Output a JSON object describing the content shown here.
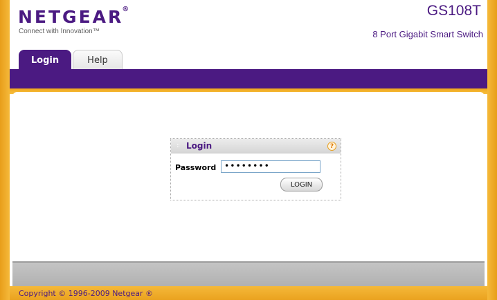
{
  "header": {
    "logo": "NETGEAR",
    "logo_mark": "®",
    "tagline": "Connect with Innovation™",
    "model": "GS108T",
    "subtitle": "8 Port Gigabit Smart Switch"
  },
  "tabs": [
    {
      "label": "Login",
      "active": true
    },
    {
      "label": "Help",
      "active": false
    }
  ],
  "login_panel": {
    "title": "Login",
    "help_icon": "?",
    "password_label": "Password",
    "password_value": "••••••••",
    "button_label": "LOGIN"
  },
  "footer": {
    "copyright": "Copyright © 1996-2009 Netgear ®"
  },
  "colors": {
    "brand_purple": "#4b1a82",
    "frame_orange": "#f0a81d",
    "footer_gray": "#b8b8b8"
  }
}
